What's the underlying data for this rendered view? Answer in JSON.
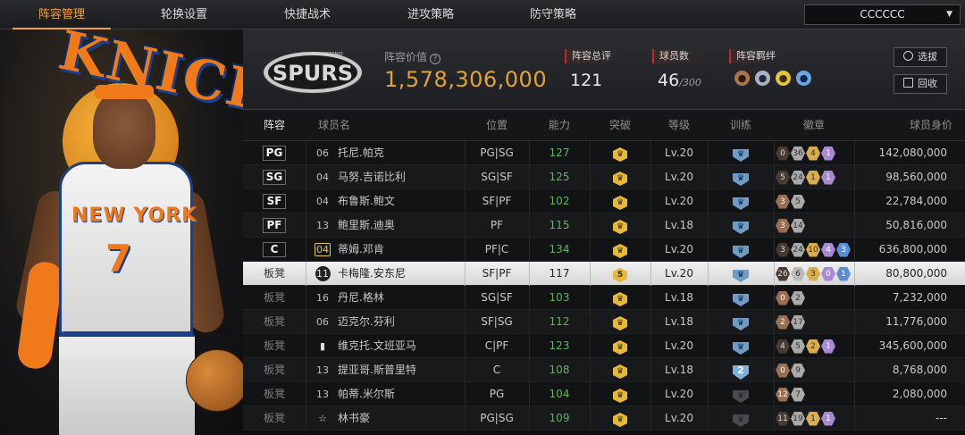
{
  "nav": {
    "tabs": [
      "阵容管理",
      "轮换设置",
      "快捷战术",
      "进攻策略",
      "防守策略"
    ],
    "active_index": 0,
    "team_select": "CCCCCC"
  },
  "summary": {
    "value_label": "阵容价值",
    "value": "1,578,306,000",
    "rating_label": "阵容总评",
    "rating": "121",
    "count_label": "球员数",
    "count": "46",
    "count_max": "/300",
    "bond_label": "阵容羁绊",
    "logo_text": "SPURS",
    "logo_sub": "SAN ANTONIO",
    "select_btn": "选拔",
    "recycle_btn": "回收"
  },
  "hero": {
    "team_word": "KNICKS",
    "jersey_text": "NEW YORK",
    "jersey_number": "7"
  },
  "table": {
    "headers": [
      "阵容",
      "球员名",
      "位置",
      "能力",
      "突破",
      "等级",
      "训练",
      "徽章",
      "球员身价"
    ],
    "rows": [
      {
        "slot": "PG",
        "num": "06",
        "name": "托尼.帕克",
        "pos": "PG|SG",
        "ability": "127",
        "level": "Lv.20",
        "value": "142,080,000",
        "badges": [
          "0",
          "36",
          "4",
          "1"
        ]
      },
      {
        "slot": "SG",
        "num": "04",
        "name": "马努.吉诺比利",
        "pos": "SG|SF",
        "ability": "125",
        "level": "Lv.20",
        "value": "98,560,000",
        "badges": [
          "5",
          "24",
          "1",
          "1"
        ]
      },
      {
        "slot": "SF",
        "num": "04",
        "name": "布鲁斯.鲍文",
        "pos": "SF|PF",
        "ability": "102",
        "level": "Lv.20",
        "value": "22,784,000",
        "badges": [
          "3",
          "5"
        ]
      },
      {
        "slot": "PF",
        "num": "13",
        "name": "鲍里斯.迪奥",
        "pos": "PF",
        "ability": "115",
        "level": "Lv.18",
        "value": "50,816,000",
        "badges": [
          "3",
          "14"
        ]
      },
      {
        "slot": "C",
        "num": "04",
        "name": "蒂姆.邓肯",
        "pos": "PF|C",
        "ability": "134",
        "level": "Lv.20",
        "value": "636,800,000",
        "badges": [
          "3",
          "24",
          "10",
          "4",
          "3"
        ]
      },
      {
        "slot": "板凳",
        "num": "11",
        "name": "卡梅隆.安东尼",
        "pos": "SF|PF",
        "ability": "117",
        "level": "Lv.20",
        "value": "80,800,000",
        "badges": [
          "26",
          "6",
          "3",
          "0",
          "1"
        ],
        "breakthrough": "5"
      },
      {
        "slot": "板凳",
        "num": "16",
        "name": "丹尼.格林",
        "pos": "SG|SF",
        "ability": "103",
        "level": "Lv.18",
        "value": "7,232,000",
        "badges": [
          "0",
          "2"
        ]
      },
      {
        "slot": "板凳",
        "num": "06",
        "name": "迈克尔.芬利",
        "pos": "SF|SG",
        "ability": "112",
        "level": "Lv.18",
        "value": "11,776,000",
        "badges": [
          "2",
          "17"
        ]
      },
      {
        "slot": "板凳",
        "num": "",
        "name": "维克托.文班亚马",
        "pos": "C|PF",
        "ability": "123",
        "level": "Lv.20",
        "value": "345,600,000",
        "badges": [
          "4",
          "5",
          "2",
          "1"
        ]
      },
      {
        "slot": "板凳",
        "num": "13",
        "name": "提亚哥.斯普里特",
        "pos": "C",
        "ability": "108",
        "level": "Lv.18",
        "value": "8,768,000",
        "badges": [
          "0",
          "9"
        ],
        "training": "2"
      },
      {
        "slot": "板凳",
        "num": "13",
        "name": "帕蒂.米尔斯",
        "pos": "PG",
        "ability": "104",
        "level": "Lv.20",
        "value": "2,080,000",
        "badges": [
          "12",
          "7"
        ]
      },
      {
        "slot": "板凳",
        "num": "",
        "name": "林书豪",
        "pos": "PG|SG",
        "ability": "109",
        "level": "Lv.20",
        "value": "---",
        "badges": [
          "11",
          "19",
          "1",
          "1"
        ]
      }
    ]
  },
  "colors": {
    "accent": "#f2a13a",
    "value_gold": "#e0a435",
    "ability_green": "#5fb25f",
    "rating_red": "#c22a2a"
  }
}
